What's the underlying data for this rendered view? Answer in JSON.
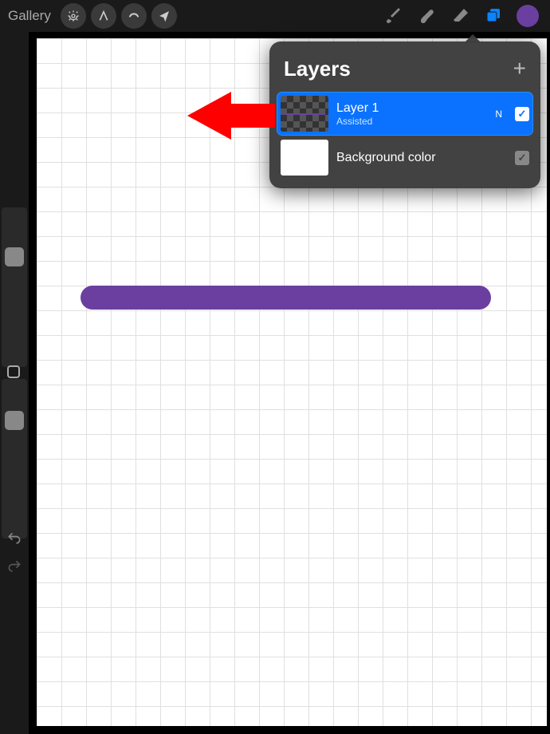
{
  "toolbar": {
    "gallery_label": "Gallery"
  },
  "layers_panel": {
    "title": "Layers",
    "add_symbol": "+",
    "layers": [
      {
        "name": "Layer 1",
        "subtitle": "Assisted",
        "badge": "N",
        "checked": true,
        "selected": true
      },
      {
        "name": "Background color",
        "subtitle": "",
        "badge": "",
        "checked": true,
        "selected": false
      }
    ]
  },
  "colors": {
    "accent": "#0a84ff",
    "stroke": "#6b3fa0"
  }
}
